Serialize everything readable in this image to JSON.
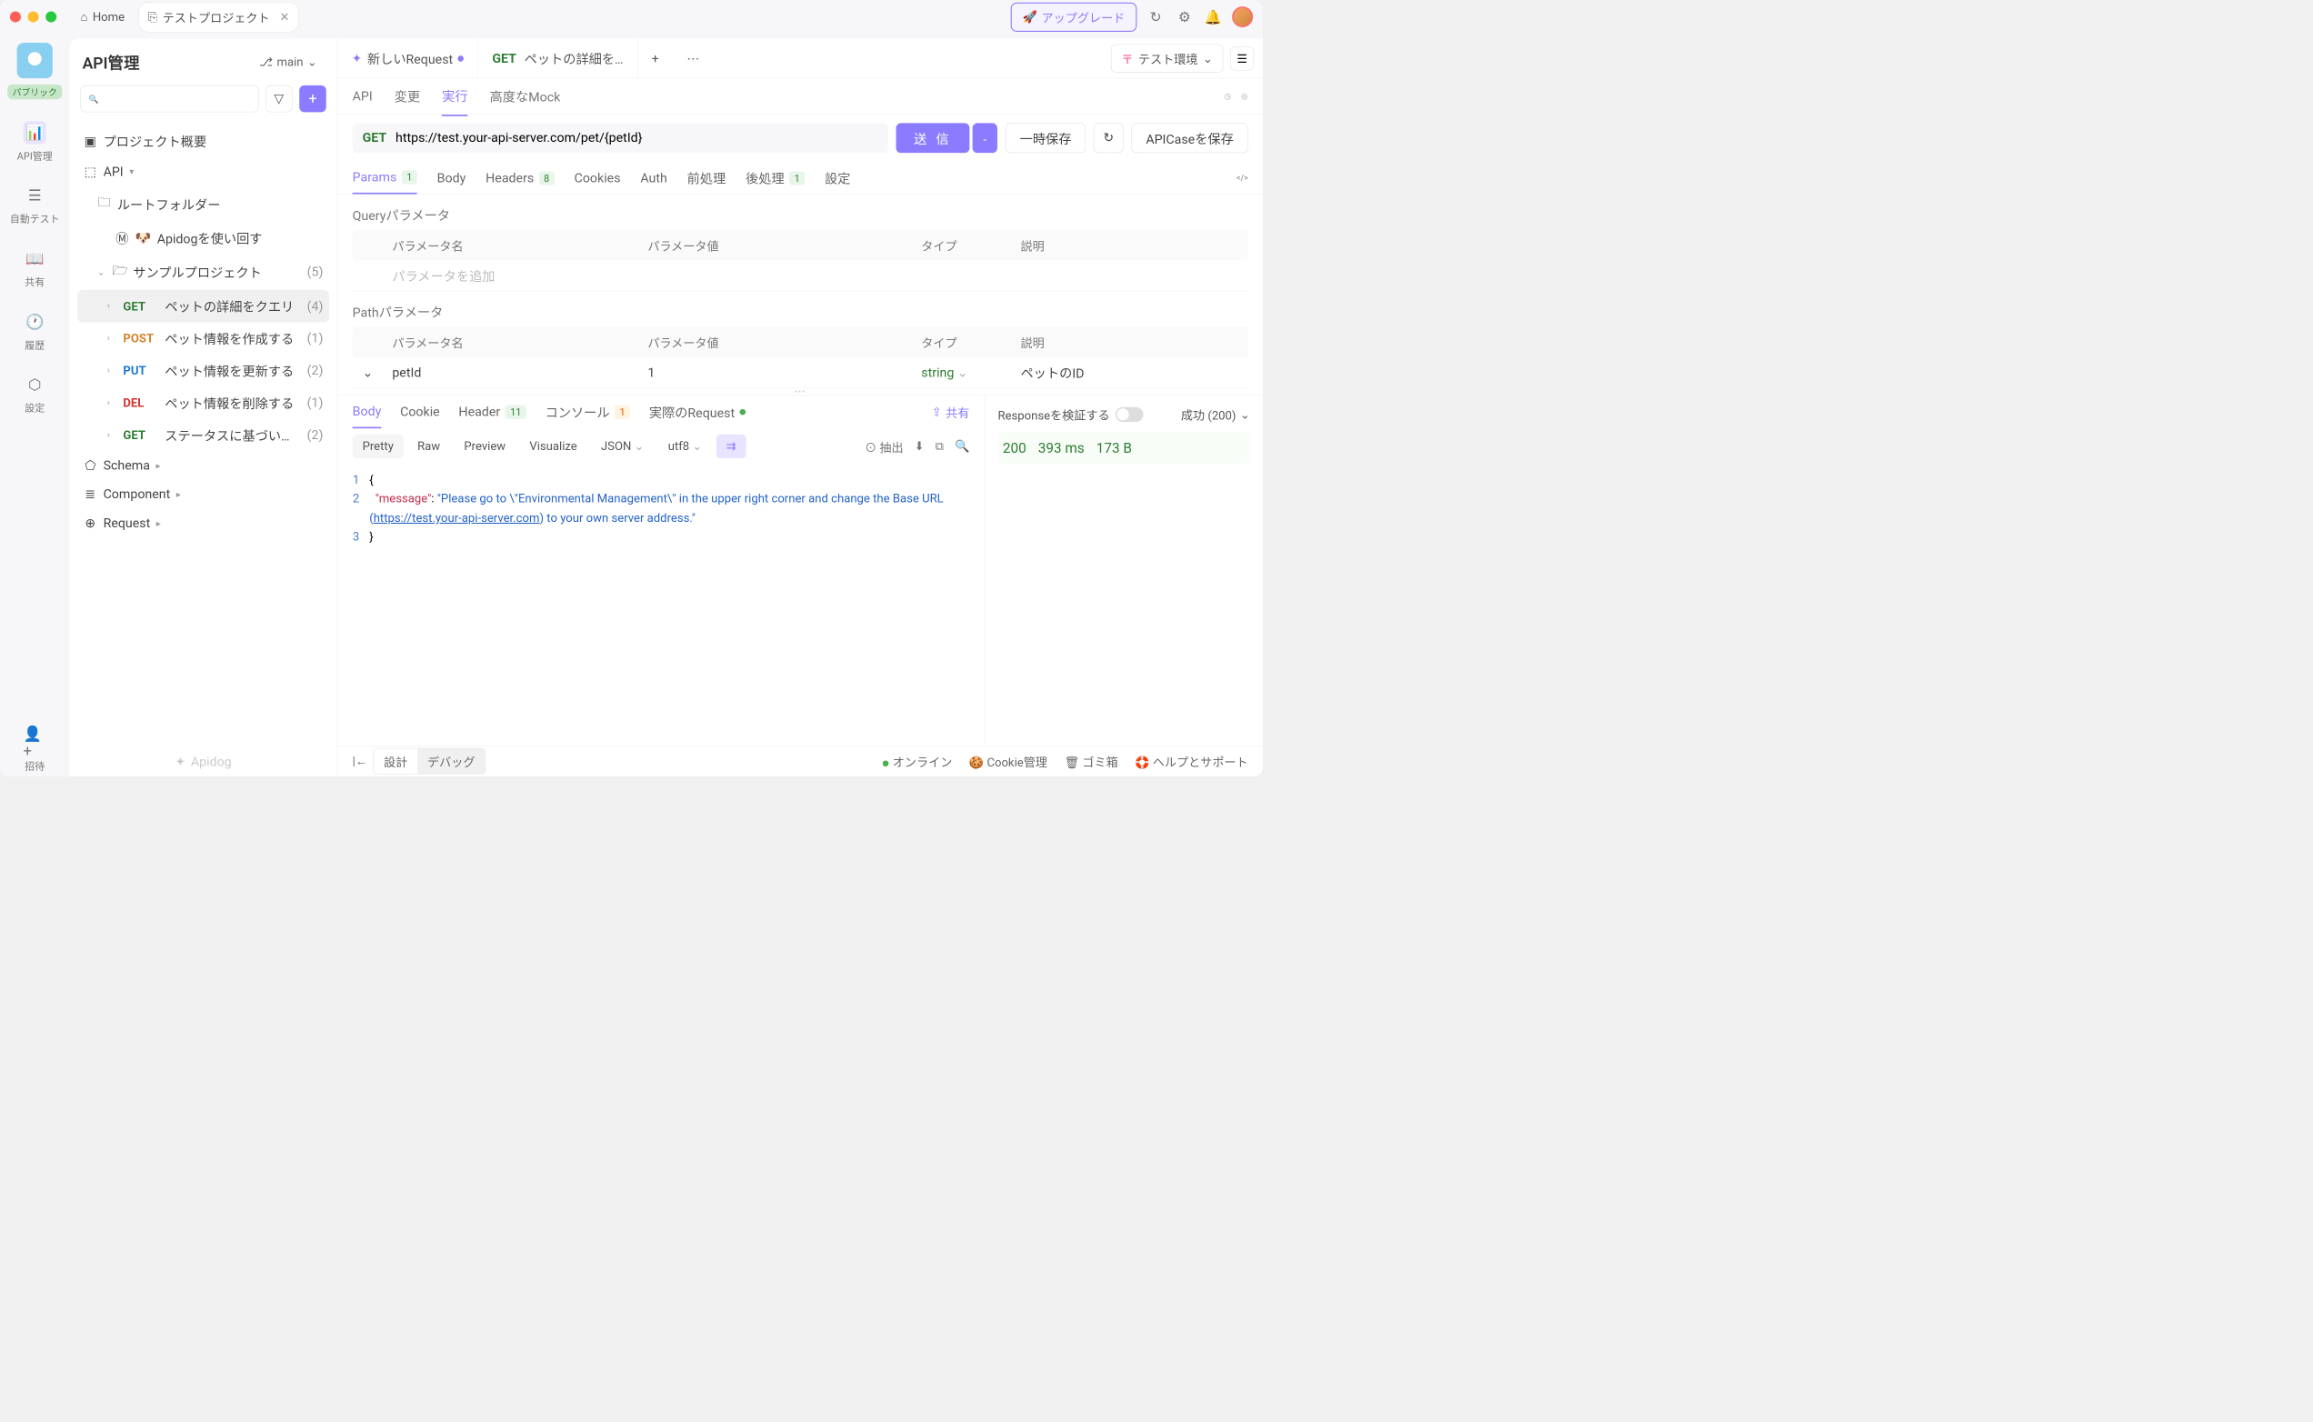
{
  "titlebar": {
    "home": "Home",
    "tab": "テストプロジェクト",
    "upgrade": "アップグレード"
  },
  "leftbar": {
    "public": "パブリック",
    "api": "API管理",
    "autotest": "自動テスト",
    "share": "共有",
    "history": "履歴",
    "settings": "設定",
    "invite": "招待"
  },
  "sidebar": {
    "title": "API管理",
    "branch": "main",
    "project_overview": "プロジェクト概要",
    "api_root": "API",
    "root_folder": "ルートフォルダー",
    "apidog_guide": "Apidogを使い回す",
    "sample_project": "サンプルプロジェクト",
    "sample_count": "(5)",
    "endpoints": [
      {
        "method": "GET",
        "label": "ペットの詳細をクエリ",
        "count": "(4)"
      },
      {
        "method": "POST",
        "label": "ペット情報を作成する",
        "count": "(1)"
      },
      {
        "method": "PUT",
        "label": "ペット情報を更新する",
        "count": "(2)"
      },
      {
        "method": "DEL",
        "label": "ペット情報を削除する",
        "count": "(1)"
      },
      {
        "method": "GET",
        "label": "ステータスに基づい…",
        "count": "(2)"
      }
    ],
    "schema": "Schema",
    "component": "Component",
    "request": "Request",
    "logo": "Apidog"
  },
  "workspace": {
    "new_request": "新しいRequest",
    "tab_method": "GET",
    "tab_label": "ペットの詳細を…",
    "env": "テスト環境",
    "subtabs": {
      "api": "API",
      "change": "変更",
      "run": "実行",
      "mock": "高度なMock"
    },
    "url_method": "GET",
    "url": "https://test.your-api-server.com/pet/{petId}",
    "send": "送 信",
    "save_temp": "一時保存",
    "save_case": "APICaseを保存",
    "req_tabs": {
      "params": "Params",
      "params_badge": "1",
      "body": "Body",
      "headers": "Headers",
      "headers_badge": "8",
      "cookies": "Cookies",
      "auth": "Auth",
      "pre": "前処理",
      "post": "後処理",
      "post_badge": "1",
      "settings": "設定"
    },
    "query_section": "Queryパラメータ",
    "path_section": "Pathパラメータ",
    "param_headers": {
      "name": "パラメータ名",
      "value": "パラメータ値",
      "type": "タイプ",
      "desc": "説明"
    },
    "add_param_placeholder": "パラメータを追加",
    "path_param": {
      "name": "petId",
      "value": "1",
      "type": "string",
      "desc": "ペットのID"
    }
  },
  "response": {
    "tabs": {
      "body": "Body",
      "cookie": "Cookie",
      "header": "Header",
      "header_badge": "11",
      "console": "コンソール",
      "console_badge": "1",
      "actual": "実際のRequest"
    },
    "share": "共有",
    "tools": {
      "pretty": "Pretty",
      "raw": "Raw",
      "preview": "Preview",
      "visualize": "Visualize",
      "json": "JSON",
      "utf8": "utf8",
      "extract": "抽出"
    },
    "code_lines": [
      "1",
      "2",
      "3"
    ],
    "json_key": "\"message\"",
    "json_str1": "\"Please go to \\\"Environmental Management\\\" in the upper right corner and change the Base URL (",
    "json_link": "https://test.your-api-server.com",
    "json_str2": ") to your own server address.\"",
    "side": {
      "validate": "Responseを検証する",
      "status_label": "成功 (200)",
      "status_code": "200",
      "time": "393 ms",
      "size": "173 B"
    }
  },
  "bottombar": {
    "design": "設計",
    "debug": "デバッグ",
    "online": "オンライン",
    "cookie": "Cookie管理",
    "trash": "ゴミ箱",
    "help": "ヘルプとサポート"
  }
}
